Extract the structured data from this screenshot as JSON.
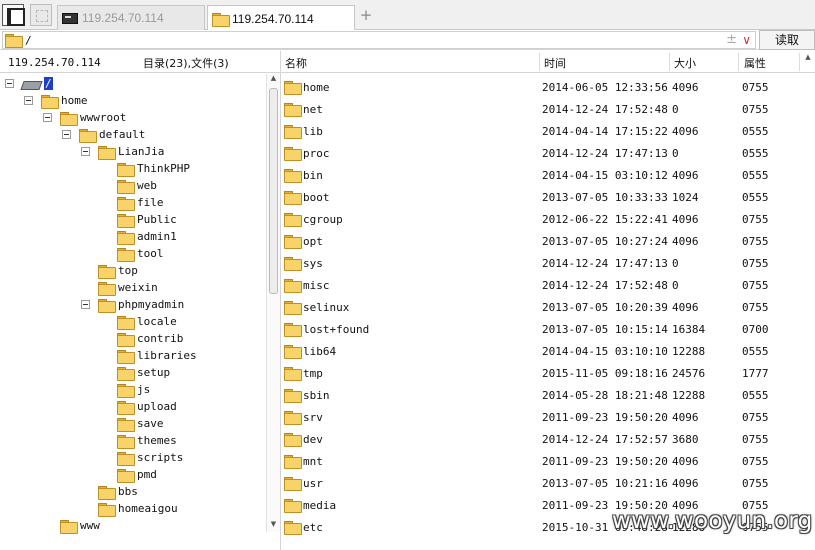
{
  "tabs": [
    {
      "label": "119.254.70.114",
      "active": false,
      "icon": "terminal-icon"
    },
    {
      "label": "119.254.70.114",
      "active": true,
      "icon": "folder-icon"
    }
  ],
  "tab_add": "+",
  "address": {
    "path": "/",
    "plus": "±",
    "dropdown": "∨"
  },
  "read_button": "读取",
  "left_header": {
    "host": "119.254.70.114",
    "counts": "目录(23),文件(3)"
  },
  "tree": [
    {
      "label": "/",
      "level": 0,
      "toggle": true,
      "icon": "drive",
      "selected": true
    },
    {
      "label": "home",
      "level": 1,
      "toggle": true
    },
    {
      "label": "wwwroot",
      "level": 2,
      "toggle": true
    },
    {
      "label": "default",
      "level": 3,
      "toggle": true
    },
    {
      "label": "LianJia",
      "level": 4,
      "toggle": true
    },
    {
      "label": "ThinkPHP",
      "level": 5,
      "toggle": false
    },
    {
      "label": "web",
      "level": 5,
      "toggle": false
    },
    {
      "label": "file",
      "level": 5,
      "toggle": false
    },
    {
      "label": "Public",
      "level": 5,
      "toggle": false
    },
    {
      "label": "admin1",
      "level": 5,
      "toggle": false
    },
    {
      "label": "tool",
      "level": 5,
      "toggle": false
    },
    {
      "label": "top",
      "level": 4,
      "toggle": false
    },
    {
      "label": "weixin",
      "level": 4,
      "toggle": false
    },
    {
      "label": "phpmyadmin",
      "level": 4,
      "toggle": true
    },
    {
      "label": "locale",
      "level": 5,
      "toggle": false
    },
    {
      "label": "contrib",
      "level": 5,
      "toggle": false
    },
    {
      "label": "libraries",
      "level": 5,
      "toggle": false
    },
    {
      "label": "setup",
      "level": 5,
      "toggle": false
    },
    {
      "label": "js",
      "level": 5,
      "toggle": false
    },
    {
      "label": "upload",
      "level": 5,
      "toggle": false
    },
    {
      "label": "save",
      "level": 5,
      "toggle": false
    },
    {
      "label": "themes",
      "level": 5,
      "toggle": false
    },
    {
      "label": "scripts",
      "level": 5,
      "toggle": false
    },
    {
      "label": "pmd",
      "level": 5,
      "toggle": false
    },
    {
      "label": "bbs",
      "level": 4,
      "toggle": false
    },
    {
      "label": "homeaigou",
      "level": 4,
      "toggle": false
    },
    {
      "label": "www",
      "level": 2,
      "toggle": false
    }
  ],
  "columns": {
    "name": "名称",
    "time": "时间",
    "size": "大小",
    "perm": "属性"
  },
  "files": [
    {
      "name": "home",
      "time": "2014-06-05 12:33:56",
      "size": "4096",
      "perm": "0755"
    },
    {
      "name": "net",
      "time": "2014-12-24 17:52:48",
      "size": "0",
      "perm": "0755"
    },
    {
      "name": "lib",
      "time": "2014-04-14 17:15:22",
      "size": "4096",
      "perm": "0555"
    },
    {
      "name": "proc",
      "time": "2014-12-24 17:47:13",
      "size": "0",
      "perm": "0555"
    },
    {
      "name": "bin",
      "time": "2014-04-15 03:10:12",
      "size": "4096",
      "perm": "0555"
    },
    {
      "name": "boot",
      "time": "2013-07-05 10:33:33",
      "size": "1024",
      "perm": "0555"
    },
    {
      "name": "cgroup",
      "time": "2012-06-22 15:22:41",
      "size": "4096",
      "perm": "0755"
    },
    {
      "name": "opt",
      "time": "2013-07-05 10:27:24",
      "size": "4096",
      "perm": "0755"
    },
    {
      "name": "sys",
      "time": "2014-12-24 17:47:13",
      "size": "0",
      "perm": "0755"
    },
    {
      "name": "misc",
      "time": "2014-12-24 17:52:48",
      "size": "0",
      "perm": "0755"
    },
    {
      "name": "selinux",
      "time": "2013-07-05 10:20:39",
      "size": "4096",
      "perm": "0755"
    },
    {
      "name": "lost+found",
      "time": "2013-07-05 10:15:14",
      "size": "16384",
      "perm": "0700"
    },
    {
      "name": "lib64",
      "time": "2014-04-15 03:10:10",
      "size": "12288",
      "perm": "0555"
    },
    {
      "name": "tmp",
      "time": "2015-11-05 09:18:16",
      "size": "24576",
      "perm": "1777"
    },
    {
      "name": "sbin",
      "time": "2014-05-28 18:21:48",
      "size": "12288",
      "perm": "0555"
    },
    {
      "name": "srv",
      "time": "2011-09-23 19:50:20",
      "size": "4096",
      "perm": "0755"
    },
    {
      "name": "dev",
      "time": "2014-12-24 17:52:57",
      "size": "3680",
      "perm": "0755"
    },
    {
      "name": "mnt",
      "time": "2011-09-23 19:50:20",
      "size": "4096",
      "perm": "0755"
    },
    {
      "name": "usr",
      "time": "2013-07-05 10:21:16",
      "size": "4096",
      "perm": "0755"
    },
    {
      "name": "media",
      "time": "2011-09-23 19:50:20",
      "size": "4096",
      "perm": "0755"
    },
    {
      "name": "etc",
      "time": "2015-10-31 09:48:28",
      "size": "12288",
      "perm": "0755"
    }
  ],
  "watermark": "www.wooyun.org"
}
